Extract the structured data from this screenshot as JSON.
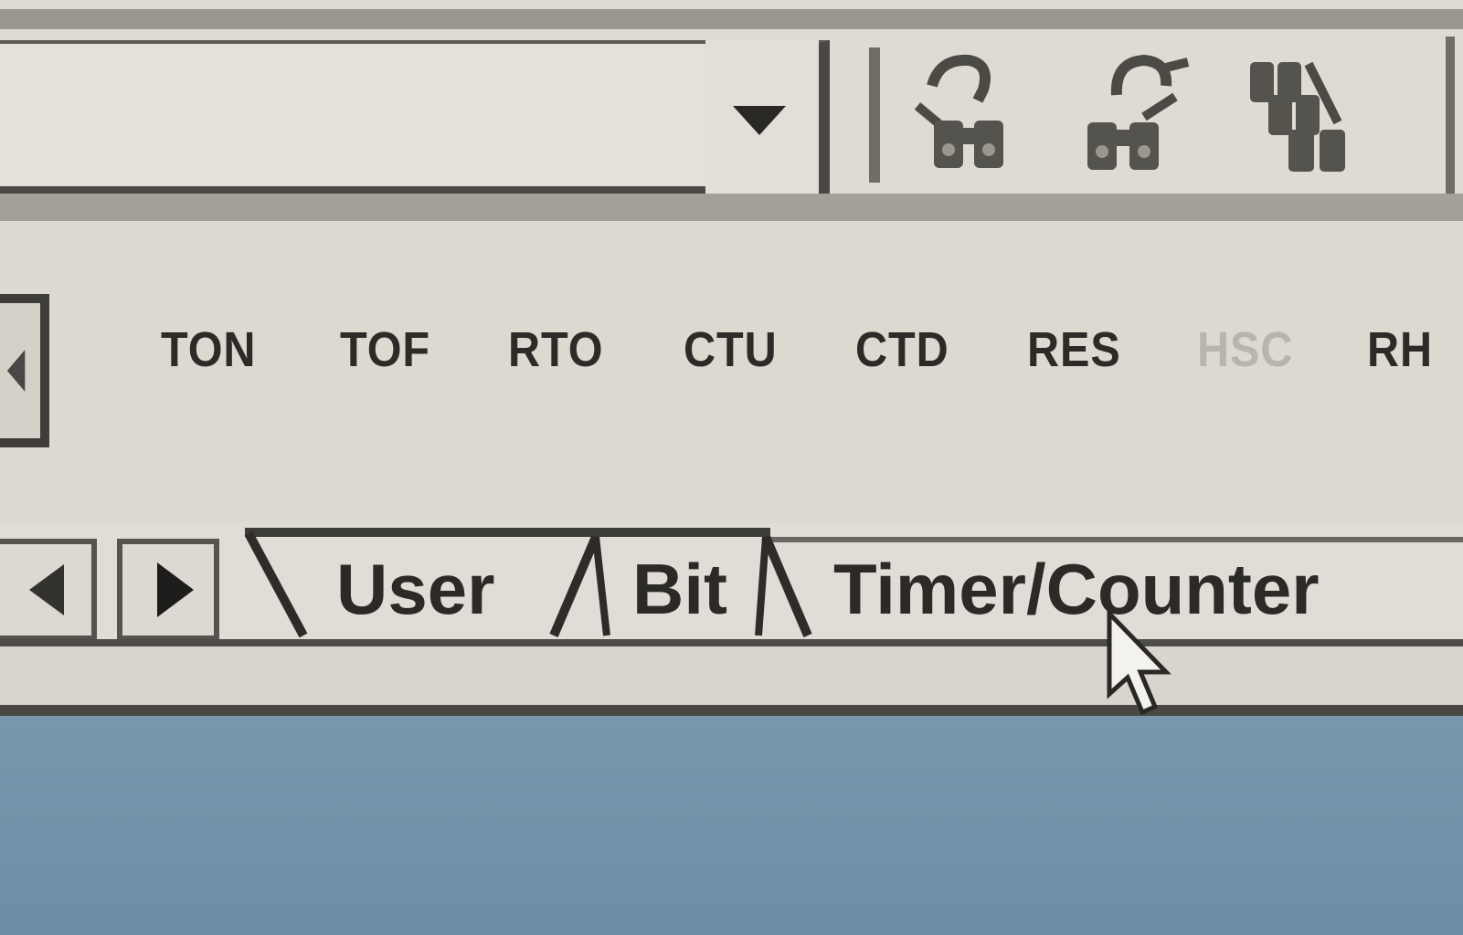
{
  "palette": {
    "instructions": [
      {
        "label": "TON",
        "enabled": true
      },
      {
        "label": "TOF",
        "enabled": true
      },
      {
        "label": "RTO",
        "enabled": true
      },
      {
        "label": "CTU",
        "enabled": true
      },
      {
        "label": "CTD",
        "enabled": true
      },
      {
        "label": "RES",
        "enabled": true
      },
      {
        "label": "HSC",
        "enabled": false
      },
      {
        "label": "RH",
        "enabled": true
      }
    ]
  },
  "tabs": {
    "items": [
      {
        "label": "User"
      },
      {
        "label": "Bit"
      },
      {
        "label": "Timer/Counter"
      }
    ],
    "active": "Timer/Counter"
  },
  "toolbar": {
    "icons": [
      "find-icon",
      "find-replace-icon",
      "find-all-icon"
    ]
  },
  "colors": {
    "background": "#d9d6cf",
    "text": "#2d2b28",
    "disabled_text": "#b8b5ad",
    "workspace": "#7391a8"
  }
}
